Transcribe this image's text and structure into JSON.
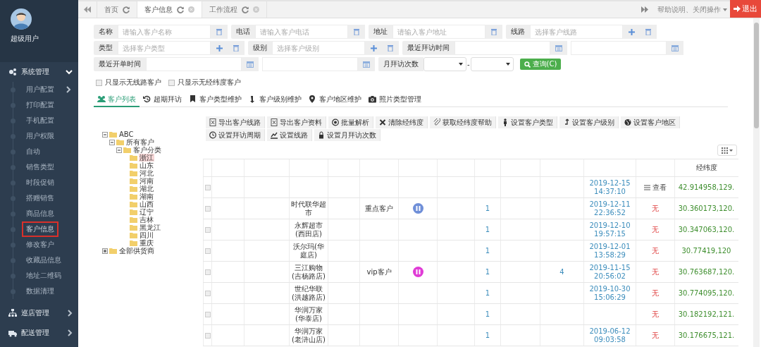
{
  "sidebar": {
    "user_name": "超级用户",
    "menu": [
      {
        "label": "系统管理",
        "expanded": true,
        "children": [
          {
            "label": "用户配置",
            "has_submenu": true,
            "selected": false
          },
          {
            "label": "打印配置",
            "has_submenu": false,
            "selected": false
          },
          {
            "label": "手机配置",
            "has_submenu": false,
            "selected": false
          },
          {
            "label": "用户权限",
            "has_submenu": false,
            "selected": false
          },
          {
            "label": "自动",
            "has_submenu": false,
            "selected": false
          },
          {
            "label": "销售类型",
            "has_submenu": false,
            "selected": false
          },
          {
            "label": "时段促销",
            "has_submenu": false,
            "selected": false
          },
          {
            "label": "搭赠销售",
            "has_submenu": false,
            "selected": false
          },
          {
            "label": "商品信息",
            "has_submenu": false,
            "selected": false
          },
          {
            "label": "客户信息",
            "has_submenu": false,
            "selected": true
          },
          {
            "label": "修改客户",
            "has_submenu": false,
            "selected": false
          },
          {
            "label": "收藏品信息",
            "has_submenu": false,
            "selected": false
          },
          {
            "label": "地址二维码",
            "has_submenu": false,
            "selected": false
          },
          {
            "label": "数据清理",
            "has_submenu": false,
            "selected": false
          }
        ]
      },
      {
        "label": "巡店管理",
        "expanded": false
      },
      {
        "label": "配送管理",
        "expanded": false
      }
    ]
  },
  "tabs": [
    {
      "label": "首页",
      "selected": false,
      "closable": false
    },
    {
      "label": "客户信息",
      "selected": true,
      "closable": true
    },
    {
      "label": "工作流程",
      "selected": false,
      "closable": true
    }
  ],
  "top_right": {
    "menu": "帮助说明、关闭操作",
    "logout": "退出"
  },
  "filters": [
    [
      {
        "kind": "text",
        "label": "名称",
        "placeholder": "请输入客户名称",
        "addable": false
      },
      {
        "kind": "text",
        "label": "电话",
        "placeholder": "请输入客户电话",
        "addable": false
      },
      {
        "kind": "text",
        "label": "地址",
        "placeholder": "请输入客户地址",
        "addable": false
      },
      {
        "kind": "text",
        "label": "线路",
        "placeholder": "选择客户线路",
        "addable": true
      }
    ],
    [
      {
        "kind": "text",
        "label": "类型",
        "placeholder": "选择客户类型",
        "addable": true
      },
      {
        "kind": "text",
        "label": "级别",
        "placeholder": "选择客户级别",
        "addable": true
      },
      {
        "kind": "daterange",
        "label": "最近拜访时间"
      }
    ],
    [
      {
        "kind": "daterange",
        "label": "最近开单时间"
      },
      {
        "kind": "select_range",
        "label": "月拜访次数",
        "separator": "-"
      },
      {
        "kind": "button",
        "label": "查询(C)"
      }
    ]
  ],
  "checkboxes": [
    {
      "label": "只显示无线路客户",
      "checked": false
    },
    {
      "label": "只显示无经纬度客户",
      "checked": false
    }
  ],
  "subtabs": [
    {
      "label": "客户列表",
      "selected": true
    },
    {
      "label": "超期拜访",
      "selected": false
    },
    {
      "label": "客户类型维护",
      "selected": false
    },
    {
      "label": "客户级别维护",
      "selected": false
    },
    {
      "label": "客户地区维护",
      "selected": false
    },
    {
      "label": "照片类型管理",
      "selected": false
    }
  ],
  "tree": [
    {
      "label": "ABC",
      "expanded": true,
      "selected": false,
      "children": [
        {
          "label": "所有客户",
          "expanded": true,
          "selected": false,
          "children": [
            {
              "label": "客户分类",
              "expanded": true,
              "selected": false,
              "children": [
                {
                  "label": "浙江",
                  "selected": true
                },
                {
                  "label": "山东",
                  "selected": false
                },
                {
                  "label": "河北",
                  "selected": false
                },
                {
                  "label": "河南",
                  "selected": false
                },
                {
                  "label": "湖北",
                  "selected": false
                },
                {
                  "label": "湖南",
                  "selected": false
                },
                {
                  "label": "山西",
                  "selected": false
                },
                {
                  "label": "辽宁",
                  "selected": false
                },
                {
                  "label": "吉林",
                  "selected": false
                },
                {
                  "label": "黑龙江",
                  "selected": false
                },
                {
                  "label": "四川",
                  "selected": false
                },
                {
                  "label": "重庆",
                  "selected": false
                }
              ]
            }
          ]
        }
      ]
    },
    {
      "label": "全部供货商",
      "expanded": false,
      "selected": false
    }
  ],
  "toolbar": [
    "导出客户线路",
    "导出客户资料",
    "批量解析",
    "清除经纬度",
    "获取经纬度帮助",
    "设置客户类型",
    "设置客户级别",
    "设置客户地区",
    "设置拜访周期",
    "设置线路",
    "设置月拜访次数"
  ],
  "table": {
    "latlng_header": "经纬度",
    "rows": [
      {
        "checked": false,
        "time": "2019-12-15 14:37:10",
        "photo": {
          "kind": "link",
          "text": "查看"
        },
        "latlng": "42.914958,129."
      },
      {
        "checked": false,
        "name": "时代联华超市",
        "type": "重点客户",
        "badge": {
          "color": "#6f8fd8"
        },
        "column_8": "1",
        "time": "2019-12-11 22:36:52",
        "photo": {
          "kind": "none",
          "text": "无"
        },
        "latlng": "30.360173,120."
      },
      {
        "checked": false,
        "name": "永辉超市(西田店)",
        "column_8": "1",
        "time": "2019-12-10 19:57:15",
        "photo": {
          "kind": "none",
          "text": "无"
        },
        "latlng": "30.347063,120."
      },
      {
        "checked": false,
        "name": "沃尔玛(华庭店)",
        "column_8": "1",
        "time": "2019-12-01 13:58:29",
        "photo": {
          "kind": "none",
          "text": "无"
        },
        "latlng": "30.77419,120"
      },
      {
        "checked": false,
        "name": "三江购物(吉杨路店)",
        "type": "vip客户",
        "badge": {
          "color": "#e03bd6"
        },
        "column_8": "1",
        "column_10": "4",
        "time": "2019-11-15 20:56:02",
        "photo": {
          "kind": "none",
          "text": "无"
        },
        "latlng": "30.763687,120."
      },
      {
        "checked": false,
        "name": "世纪华联(洪越路店)",
        "column_8": "1",
        "time": "2019-10-30 15:06:29",
        "photo": {
          "kind": "none",
          "text": "无"
        },
        "latlng": "30.774095,120."
      },
      {
        "checked": false,
        "name": "华润万家(华泰店)",
        "column_8": "1",
        "photo": {
          "kind": "none",
          "text": "无"
        },
        "latlng": "30.182192,121."
      },
      {
        "checked": false,
        "name": "华润万家(老浒山店)",
        "column_8": "1",
        "time": "2019-06-12 09:03:58",
        "photo": {
          "kind": "none",
          "text": "无"
        },
        "latlng": "30.176675,121."
      }
    ]
  }
}
